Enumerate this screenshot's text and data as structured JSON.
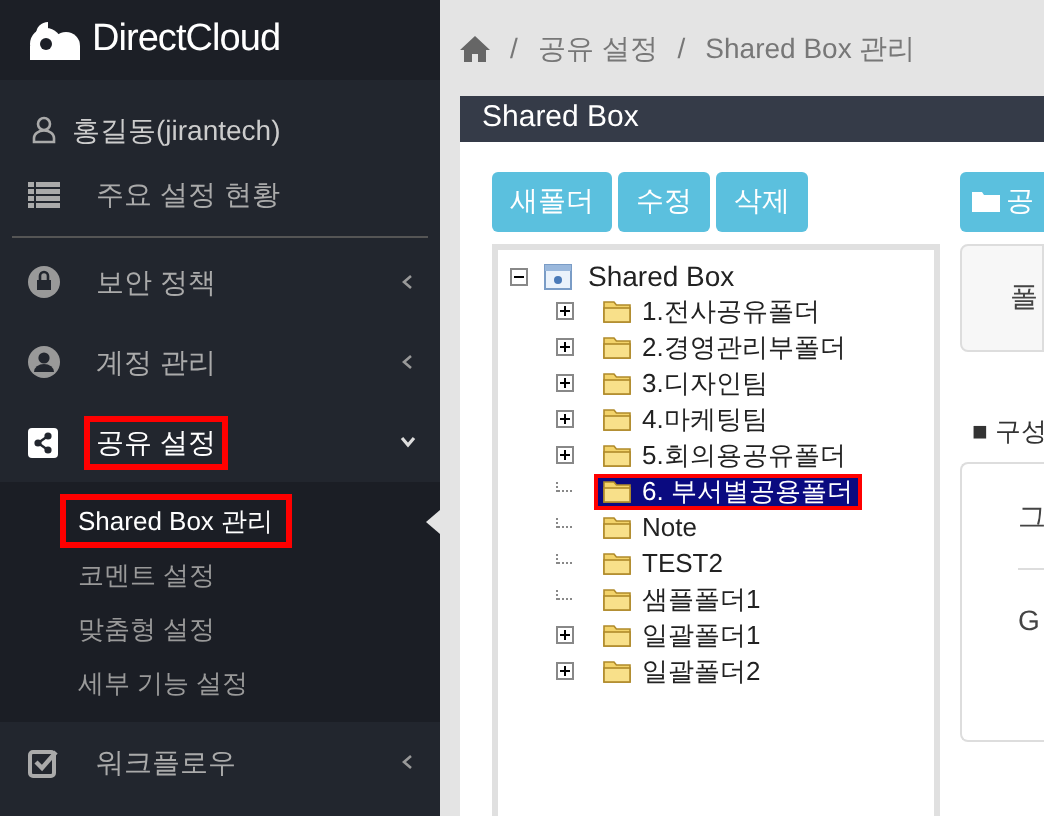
{
  "logo": {
    "text": "DirectCloud"
  },
  "sidebar": {
    "user": "홍길동(jirantech)",
    "items": [
      {
        "kind": "summary",
        "label": "주요 설정 현황",
        "expanded": false,
        "highlighted": false
      },
      {
        "kind": "lock",
        "label": "보안 정책",
        "expanded": false,
        "highlighted": false
      },
      {
        "kind": "account",
        "label": "계정 관리",
        "expanded": false,
        "highlighted": false
      },
      {
        "kind": "share",
        "label": "공유 설정",
        "expanded": true,
        "highlighted": true,
        "children": [
          {
            "label": "Shared Box 관리",
            "selected": true,
            "highlighted": true
          },
          {
            "label": "코멘트 설정",
            "selected": false,
            "highlighted": false
          },
          {
            "label": "맞춤형 설정",
            "selected": false,
            "highlighted": false
          },
          {
            "label": "세부 기능 설정",
            "selected": false,
            "highlighted": false
          }
        ]
      },
      {
        "kind": "check",
        "label": "워크플로우",
        "expanded": false,
        "highlighted": false
      }
    ]
  },
  "breadcrumb": [
    {
      "separator": "/",
      "label": "공유 설정"
    },
    {
      "separator": "/",
      "label": "Shared Box 관리"
    }
  ],
  "panel": {
    "title": "Shared Box",
    "buttons": [
      "새폴더",
      "수정",
      "삭제"
    ],
    "tree": {
      "label": "Shared Box",
      "expanded": true,
      "children": [
        {
          "label": "1.전사공유폴더",
          "has_children": true,
          "selected": false
        },
        {
          "label": "2.경영관리부폴더",
          "has_children": true,
          "selected": false
        },
        {
          "label": "3.디자인팀",
          "has_children": true,
          "selected": false
        },
        {
          "label": "4.마케팅팀",
          "has_children": true,
          "selected": false
        },
        {
          "label": "5.회의용공유폴더",
          "has_children": true,
          "selected": false
        },
        {
          "label": "6. 부서별공용폴더",
          "has_children": false,
          "selected": true,
          "highlighted": true
        },
        {
          "label": "Note",
          "has_children": false,
          "selected": false
        },
        {
          "label": "TEST2",
          "has_children": false,
          "selected": false
        },
        {
          "label": "샘플폴더1",
          "has_children": false,
          "selected": false
        },
        {
          "label": "일괄폴더1",
          "has_children": true,
          "selected": false
        },
        {
          "label": "일괄폴더2",
          "has_children": true,
          "selected": false
        }
      ]
    },
    "right": {
      "button": "공",
      "box_text": "폴",
      "section_title": "■ 구성",
      "rows": [
        "그",
        "G"
      ]
    }
  }
}
